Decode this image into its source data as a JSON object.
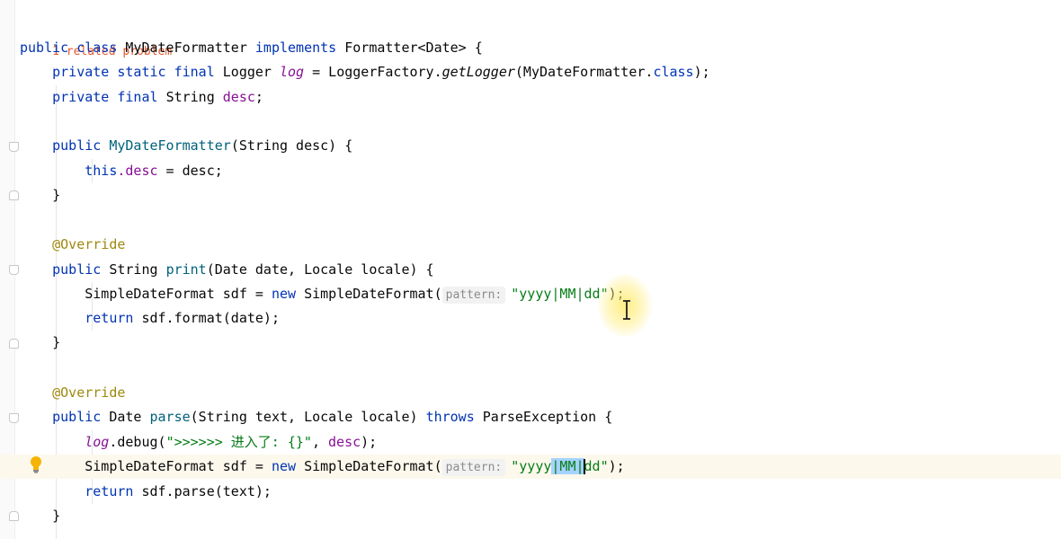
{
  "problems_banner": "1 related problem",
  "code": {
    "class_decl": {
      "kw_public": "public",
      "kw_class": "class",
      "class_name": "MyDateFormatter",
      "kw_implements": "implements",
      "iface": "Formatter<Date> {"
    },
    "log_decl": {
      "mods": "private static final",
      "type": "Logger",
      "name": "log",
      "assign": " = LoggerFactory.",
      "method": "getLogger",
      "arg": "(MyDateFormatter.",
      "kw_class": "class",
      "end": ");"
    },
    "desc_decl": {
      "mods": "private final",
      "type": "String",
      "name": "desc",
      "end": ";"
    },
    "ctor": {
      "kw_public": "public",
      "name": "MyDateFormatter",
      "params": "(String desc) {",
      "this_kw": "this",
      "this_field": ".desc",
      "this_rest": " = desc;",
      "close": "}"
    },
    "print_method": {
      "annotation": "@Override",
      "kw_public": "public",
      "ret": "String",
      "name": "print",
      "params": "(Date date, Locale locale) {",
      "sdf_decl": "SimpleDateFormat sdf = ",
      "kw_new": "new",
      "sdf_ctor": " SimpleDateFormat(",
      "hint": "pattern:",
      "pattern": "\"yyyy|MM|dd\"",
      "end": ");",
      "kw_return": "return",
      "return_rest": " sdf.format(date);",
      "close": "}"
    },
    "parse_method": {
      "annotation": "@Override",
      "kw_public": "public",
      "ret": "Date",
      "name": "parse",
      "params": "(String text, Locale locale) ",
      "kw_throws": "throws",
      "throws_rest": " ParseException {",
      "log_var": "log",
      "log_call": ".debug(",
      "log_str": "\">>>>>> 进入了: {}\"",
      "log_rest": ", ",
      "log_field": "desc",
      "log_end": ");",
      "sdf_decl": "SimpleDateFormat sdf = ",
      "kw_new": "new",
      "sdf_ctor": " SimpleDateFormat(",
      "hint": "pattern:",
      "pattern_pre": "\"yyyy",
      "pattern_sel": "|MM|",
      "pattern_post": "dd\"",
      "end": ");",
      "kw_return": "return",
      "return_rest": " sdf.parse(text);",
      "close": "}"
    }
  },
  "icons": {
    "intention": "lightbulb-icon",
    "cursor": "text-cursor-icon"
  },
  "colors": {
    "keyword": "#0033b3",
    "string": "#067d17",
    "annotation": "#9e880d",
    "field": "#871094",
    "method": "#00627a",
    "problem": "#e4572e",
    "selection": "#a6d2ff"
  }
}
